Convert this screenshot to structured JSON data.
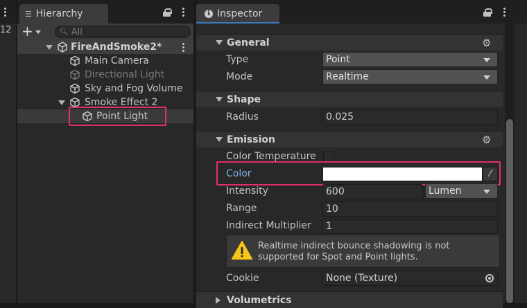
{
  "left_panel": {
    "number": "12"
  },
  "hierarchy": {
    "tab_label": "Hierarchy",
    "add_label": "+",
    "search_placeholder": "All",
    "scene_name": "FireAndSmoke2*",
    "items": [
      {
        "label": "Main Camera"
      },
      {
        "label": "Directional Light"
      },
      {
        "label": "Sky and Fog Volume"
      },
      {
        "label": "Smoke Effect 2"
      },
      {
        "label": "Point Light"
      }
    ]
  },
  "inspector": {
    "tab_label": "Inspector",
    "general": {
      "title": "General",
      "type_label": "Type",
      "type_value": "Point",
      "mode_label": "Mode",
      "mode_value": "Realtime"
    },
    "shape": {
      "title": "Shape",
      "radius_label": "Radius",
      "radius_value": "0.025"
    },
    "emission": {
      "title": "Emission",
      "color_temperature_label": "Color Temperature",
      "color_label": "Color",
      "color_value": "#ffffff",
      "intensity_label": "Intensity",
      "intensity_value": "600",
      "intensity_unit": "Lumen",
      "range_label": "Range",
      "range_value": "10",
      "indirect_label": "Indirect Multiplier",
      "indirect_value": "1",
      "help_text": "Realtime indirect bounce shadowing is not supported for Spot and Point lights.",
      "cookie_label": "Cookie",
      "cookie_value": "None (Texture)"
    },
    "volumetrics": {
      "title": "Volumetrics"
    }
  },
  "colors": {
    "highlight": "#e0306a",
    "accent_blue": "#3a79bb",
    "warning_yellow": "#f5c518"
  }
}
